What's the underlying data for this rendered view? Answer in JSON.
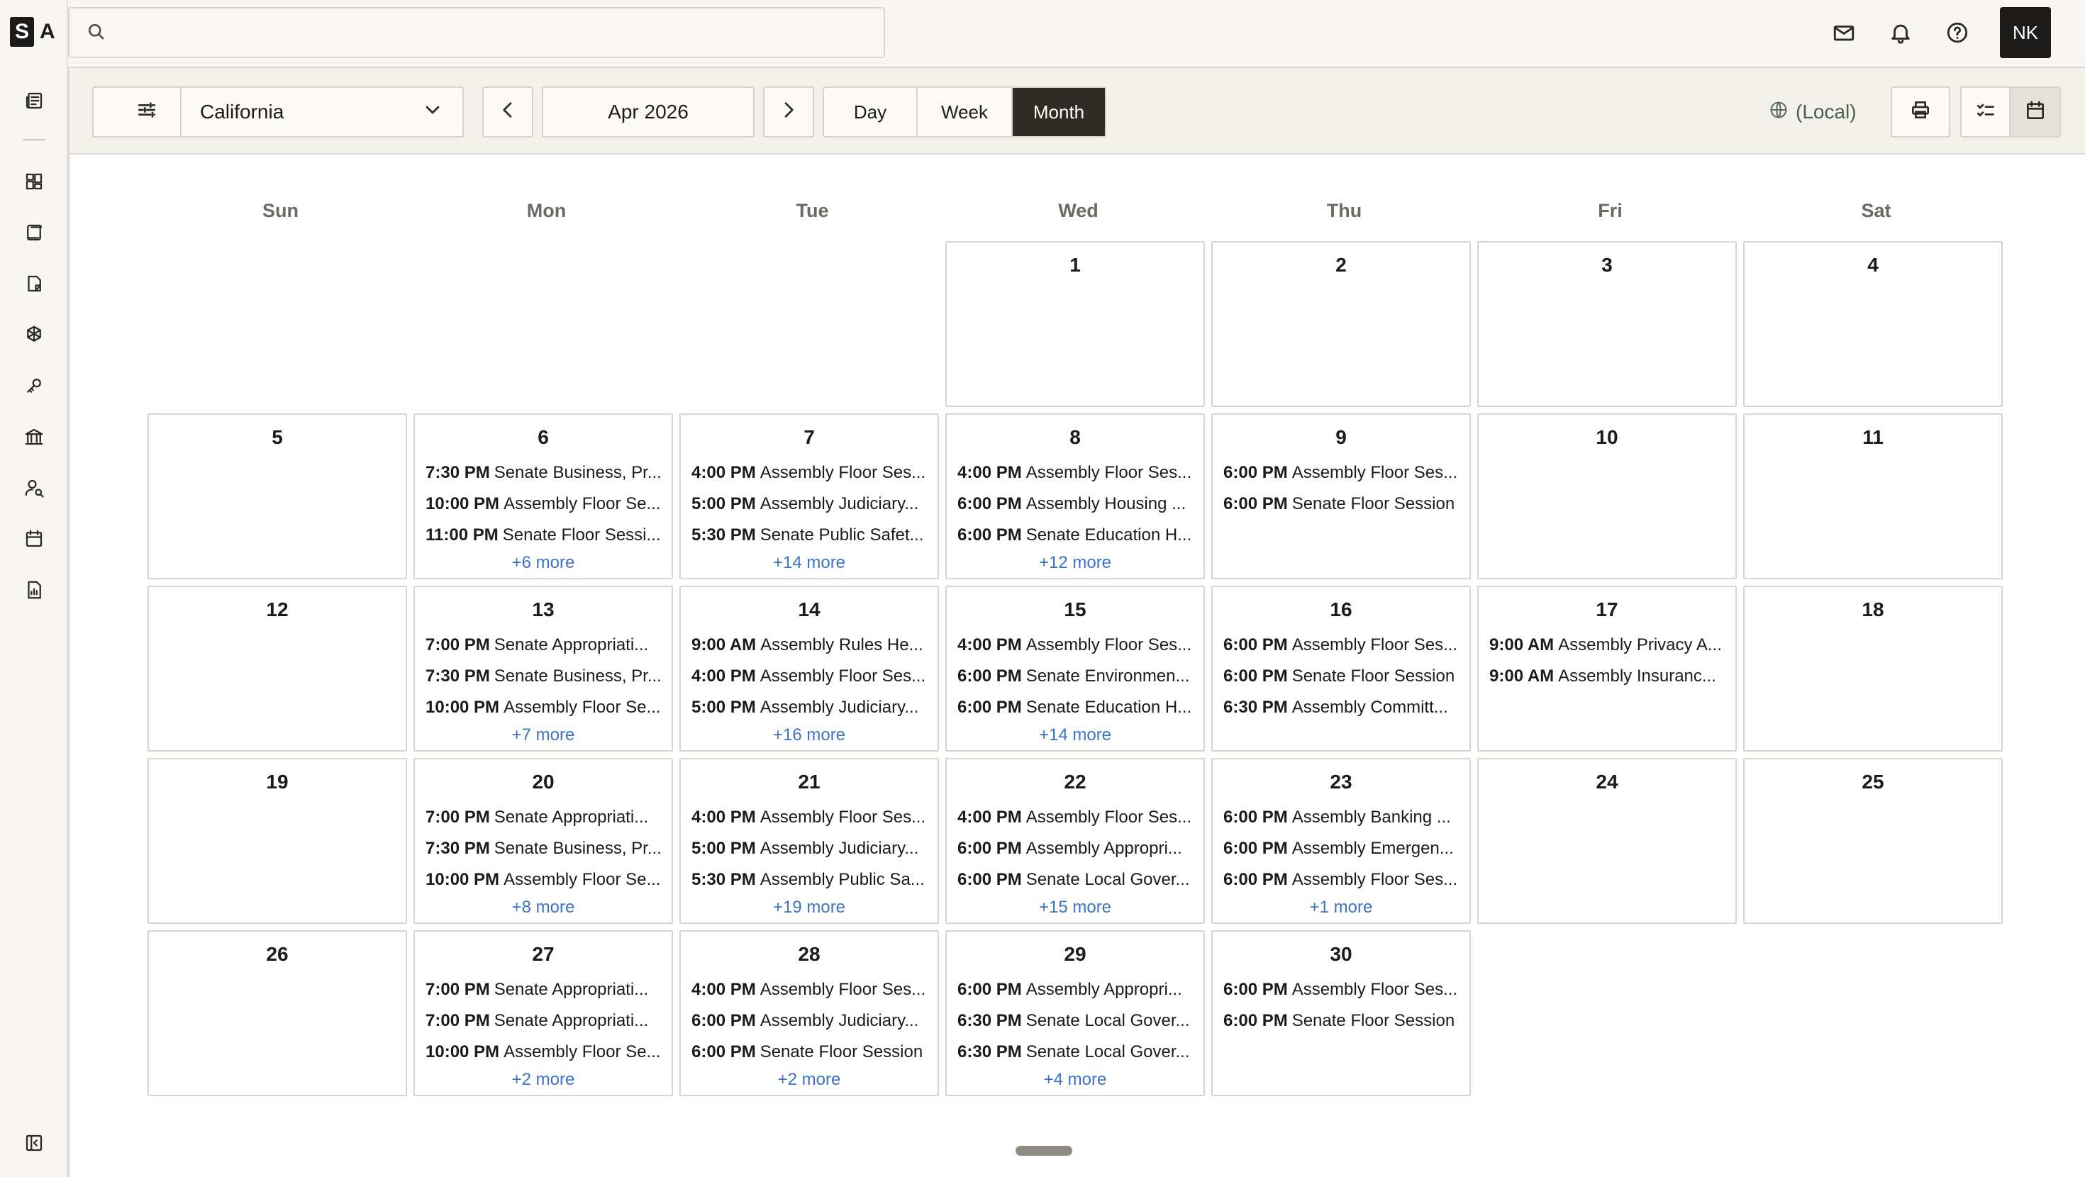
{
  "brand": {
    "letters": [
      "S",
      "A"
    ]
  },
  "search": {
    "placeholder": "",
    "value": ""
  },
  "user": {
    "initials": "NK"
  },
  "toolbar": {
    "state": "California",
    "date": "Apr 2026",
    "views": [
      "Day",
      "Week",
      "Month"
    ],
    "active_view": "Month",
    "timezone": "(Local)"
  },
  "calendar": {
    "weekdays": [
      "Sun",
      "Mon",
      "Tue",
      "Wed",
      "Thu",
      "Fri",
      "Sat"
    ],
    "leading_blanks": 3,
    "days": [
      {
        "day": "1",
        "events": [],
        "more": ""
      },
      {
        "day": "2",
        "events": [],
        "more": ""
      },
      {
        "day": "3",
        "events": [],
        "more": ""
      },
      {
        "day": "4",
        "events": [],
        "more": ""
      },
      {
        "day": "5",
        "events": [],
        "more": ""
      },
      {
        "day": "6",
        "events": [
          [
            "7:30 PM",
            "Senate Business, Pr..."
          ],
          [
            "10:00 PM",
            "Assembly Floor Se..."
          ],
          [
            "11:00 PM",
            "Senate Floor Sessi..."
          ]
        ],
        "more": "+6 more"
      },
      {
        "day": "7",
        "events": [
          [
            "4:00 PM",
            "Assembly Floor Ses..."
          ],
          [
            "5:00 PM",
            "Assembly Judiciary..."
          ],
          [
            "5:30 PM",
            "Senate Public Safet..."
          ]
        ],
        "more": "+14 more"
      },
      {
        "day": "8",
        "events": [
          [
            "4:00 PM",
            "Assembly Floor Ses..."
          ],
          [
            "6:00 PM",
            "Assembly Housing ..."
          ],
          [
            "6:00 PM",
            "Senate Education H..."
          ]
        ],
        "more": "+12 more"
      },
      {
        "day": "9",
        "events": [
          [
            "6:00 PM",
            "Assembly Floor Ses..."
          ],
          [
            "6:00 PM",
            "Senate Floor Session"
          ]
        ],
        "more": ""
      },
      {
        "day": "10",
        "events": [],
        "more": ""
      },
      {
        "day": "11",
        "events": [],
        "more": ""
      },
      {
        "day": "12",
        "events": [],
        "more": ""
      },
      {
        "day": "13",
        "events": [
          [
            "7:00 PM",
            "Senate Appropriati..."
          ],
          [
            "7:30 PM",
            "Senate Business, Pr..."
          ],
          [
            "10:00 PM",
            "Assembly Floor Se..."
          ]
        ],
        "more": "+7 more"
      },
      {
        "day": "14",
        "events": [
          [
            "9:00 AM",
            "Assembly Rules He..."
          ],
          [
            "4:00 PM",
            "Assembly Floor Ses..."
          ],
          [
            "5:00 PM",
            "Assembly Judiciary..."
          ]
        ],
        "more": "+16 more"
      },
      {
        "day": "15",
        "events": [
          [
            "4:00 PM",
            "Assembly Floor Ses..."
          ],
          [
            "6:00 PM",
            "Senate Environmen..."
          ],
          [
            "6:00 PM",
            "Senate Education H..."
          ]
        ],
        "more": "+14 more"
      },
      {
        "day": "16",
        "events": [
          [
            "6:00 PM",
            "Assembly Floor Ses..."
          ],
          [
            "6:00 PM",
            "Senate Floor Session"
          ],
          [
            "6:30 PM",
            "Assembly Committ..."
          ]
        ],
        "more": ""
      },
      {
        "day": "17",
        "events": [
          [
            "9:00 AM",
            "Assembly Privacy A..."
          ],
          [
            "9:00 AM",
            "Assembly Insuranc..."
          ]
        ],
        "more": ""
      },
      {
        "day": "18",
        "events": [],
        "more": ""
      },
      {
        "day": "19",
        "events": [],
        "more": ""
      },
      {
        "day": "20",
        "events": [
          [
            "7:00 PM",
            "Senate Appropriati..."
          ],
          [
            "7:30 PM",
            "Senate Business, Pr..."
          ],
          [
            "10:00 PM",
            "Assembly Floor Se..."
          ]
        ],
        "more": "+8 more"
      },
      {
        "day": "21",
        "events": [
          [
            "4:00 PM",
            "Assembly Floor Ses..."
          ],
          [
            "5:00 PM",
            "Assembly Judiciary..."
          ],
          [
            "5:30 PM",
            "Assembly Public Sa..."
          ]
        ],
        "more": "+19 more"
      },
      {
        "day": "22",
        "events": [
          [
            "4:00 PM",
            "Assembly Floor Ses..."
          ],
          [
            "6:00 PM",
            "Assembly Appropri..."
          ],
          [
            "6:00 PM",
            "Senate Local Gover..."
          ]
        ],
        "more": "+15 more"
      },
      {
        "day": "23",
        "events": [
          [
            "6:00 PM",
            "Assembly Banking ..."
          ],
          [
            "6:00 PM",
            "Assembly Emergen..."
          ],
          [
            "6:00 PM",
            "Assembly Floor Ses..."
          ]
        ],
        "more": "+1 more"
      },
      {
        "day": "24",
        "events": [],
        "more": ""
      },
      {
        "day": "25",
        "events": [],
        "more": ""
      },
      {
        "day": "26",
        "events": [],
        "more": ""
      },
      {
        "day": "27",
        "events": [
          [
            "7:00 PM",
            "Senate Appropriati..."
          ],
          [
            "7:00 PM",
            "Senate Appropriati..."
          ],
          [
            "10:00 PM",
            "Assembly Floor Se..."
          ]
        ],
        "more": "+2 more"
      },
      {
        "day": "28",
        "events": [
          [
            "4:00 PM",
            "Assembly Floor Ses..."
          ],
          [
            "6:00 PM",
            "Assembly Judiciary..."
          ],
          [
            "6:00 PM",
            "Senate Floor Session"
          ]
        ],
        "more": "+2 more"
      },
      {
        "day": "29",
        "events": [
          [
            "6:00 PM",
            "Assembly Appropri..."
          ],
          [
            "6:30 PM",
            "Senate Local Gover..."
          ],
          [
            "6:30 PM",
            "Senate Local Gover..."
          ]
        ],
        "more": "+4 more"
      },
      {
        "day": "30",
        "events": [
          [
            "6:00 PM",
            "Assembly Floor Ses..."
          ],
          [
            "6:00 PM",
            "Senate Floor Session"
          ]
        ],
        "more": ""
      }
    ]
  },
  "colors": {
    "accent": "#2e2a24",
    "link": "#3a73c8",
    "timezone": "#4b5e52"
  },
  "icons": {
    "rail": [
      "news-icon",
      "dashboard-icon",
      "bills-icon",
      "document-icon",
      "network-icon",
      "key-icon",
      "capitol-icon",
      "person-search-icon",
      "calendar-icon",
      "report-icon",
      "collapse-sidebar-icon"
    ],
    "top": [
      "mail-icon",
      "bell-icon",
      "help-icon"
    ]
  }
}
